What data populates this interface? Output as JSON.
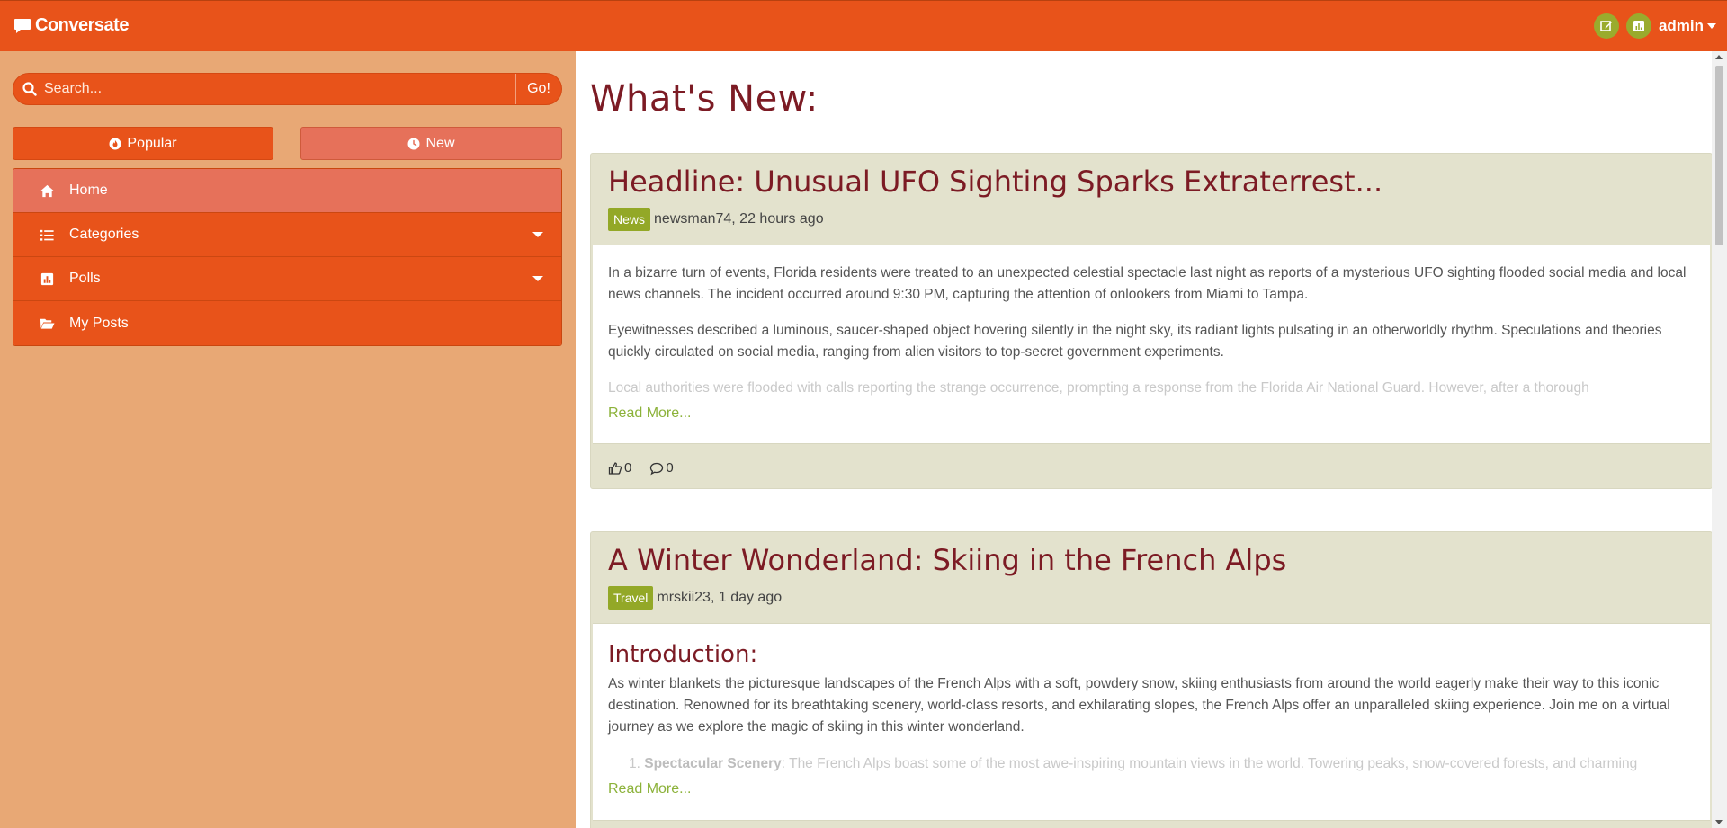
{
  "navbar": {
    "brand": "Conversate",
    "user": "admin",
    "icons": [
      "edit-icon",
      "poll-icon"
    ],
    "accent": "#e8531a",
    "button_color": "#9aab2d"
  },
  "sidebar": {
    "search_placeholder": "Search...",
    "go_label": "Go!",
    "tabs": [
      {
        "label": "Popular",
        "icon": "fire-icon"
      },
      {
        "label": "New",
        "icon": "clock-icon"
      }
    ],
    "items": [
      {
        "label": "Home",
        "icon": "home-icon",
        "active": true
      },
      {
        "label": "Categories",
        "icon": "list-icon",
        "dropdown": true
      },
      {
        "label": "Polls",
        "icon": "poll-icon",
        "dropdown": true
      },
      {
        "label": "My Posts",
        "icon": "folder-open-icon"
      }
    ]
  },
  "main": {
    "page_title": "What's New:",
    "posts": [
      {
        "title": "Headline: Unusual UFO Sighting Sparks Extraterrest...",
        "category": "News",
        "meta": "newsman74, 22 hours ago",
        "paragraphs": [
          "In a bizarre turn of events, Florida residents were treated to an unexpected celestial spectacle last night as reports of a mysterious UFO sighting flooded social media and local news channels. The incident occurred around 9:30 PM, capturing the attention of onlookers from Miami to Tampa.",
          "Eyewitnesses described a luminous, saucer-shaped object hovering silently in the night sky, its radiant lights pulsating in an otherworldly rhythm. Speculations and theories quickly circulated on social media, ranging from alien visitors to top-secret government experiments.",
          "Local authorities were flooded with calls reporting the strange occurrence, prompting a response from the Florida Air National Guard. However, after a thorough"
        ],
        "read_more": "Read More...",
        "likes": "0",
        "comments": "0"
      },
      {
        "title": "A Winter Wonderland: Skiing in the French Alps",
        "category": "Travel",
        "meta": "mrskii23, 1 day ago",
        "heading": "Introduction:",
        "paragraphs": [
          "As winter blankets the picturesque landscapes of the French Alps with a soft, powdery snow, skiing enthusiasts from around the world eagerly make their way to this iconic destination. Renowned for its breathtaking scenery, world-class resorts, and exhilarating slopes, the French Alps offer an unparalleled skiing experience. Join me on a virtual journey as we explore the magic of skiing in this winter wonderland."
        ],
        "list_item_bold": "Spectacular Scenery",
        "list_item_text": ": The French Alps boast some of the most awe-inspiring mountain views in the world. Towering peaks, snow-covered forests, and charming",
        "list_number": "1.",
        "read_more": "Read More..."
      }
    ]
  }
}
